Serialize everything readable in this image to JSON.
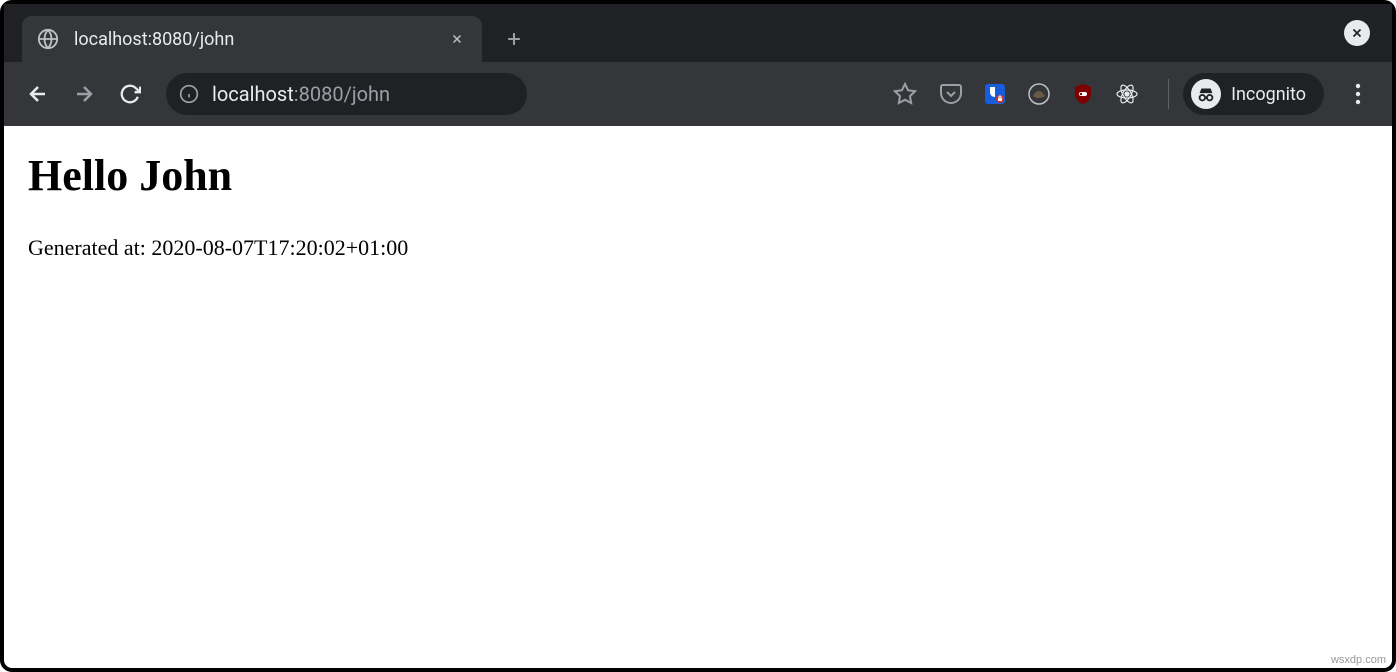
{
  "tab": {
    "title": "localhost:8080/john"
  },
  "address": {
    "host": "localhost",
    "path": ":8080/john"
  },
  "incognito": {
    "label": "Incognito"
  },
  "page": {
    "heading": "Hello John",
    "generated_text": "Generated at: 2020-08-07T17:20:02+01:00"
  },
  "watermark": "wsxdp.com"
}
